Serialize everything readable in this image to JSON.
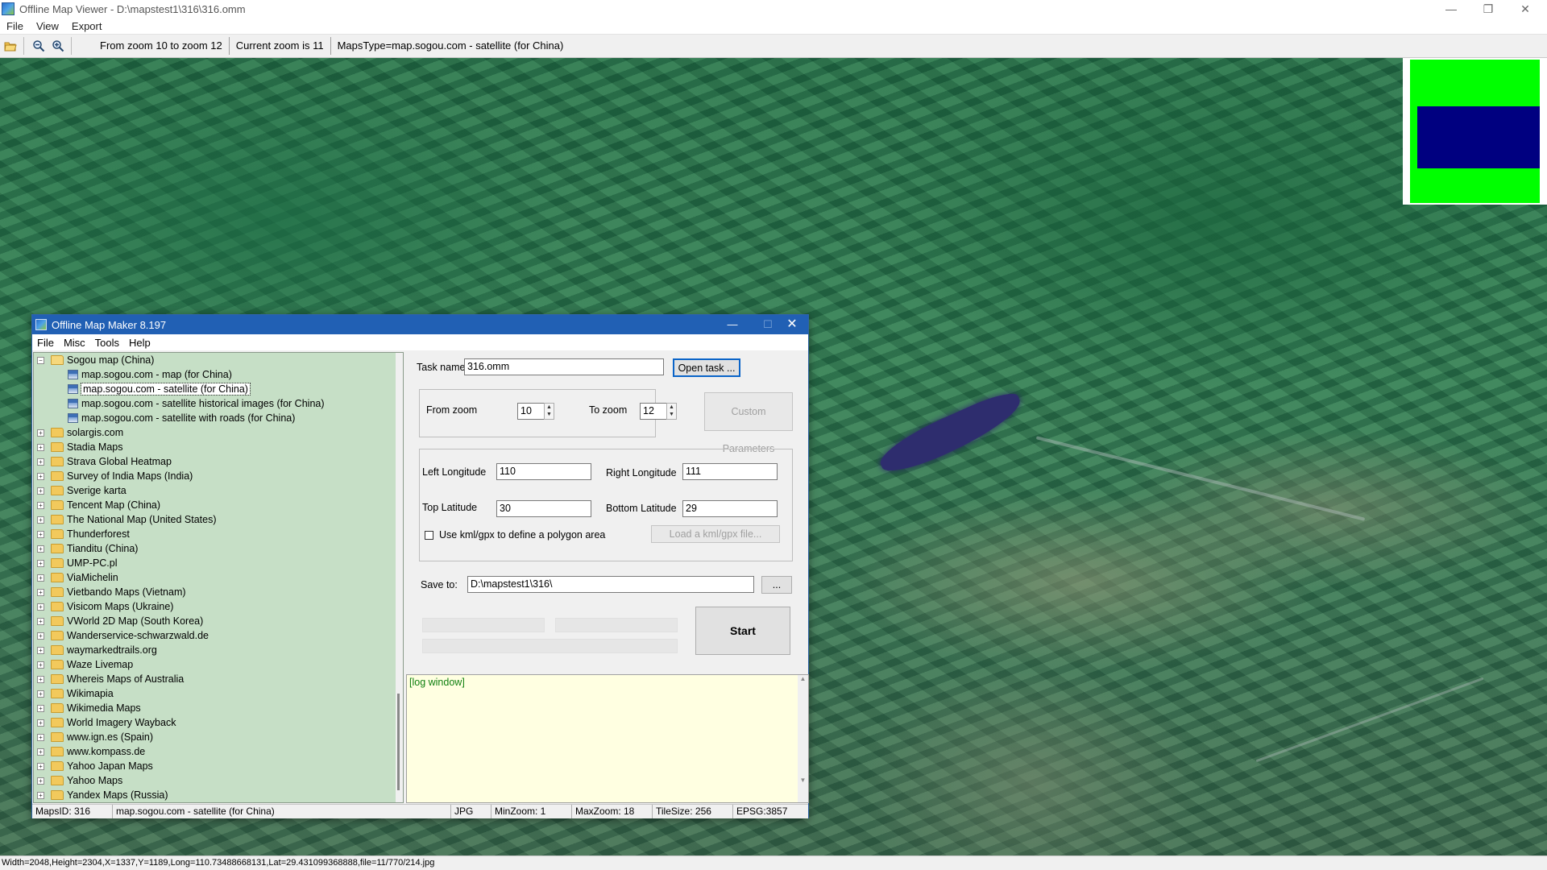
{
  "viewer": {
    "title": "Offline Map Viewer - D:\\mapstest1\\316\\316.omm",
    "window_controls": {
      "minimize": "—",
      "maximize": "❐",
      "close": "✕"
    },
    "menu": [
      "File",
      "View",
      "Export"
    ],
    "toolbar": {
      "zoom_range": "From zoom 10 to zoom 12",
      "current_zoom": "Current zoom is 11",
      "maps_type": "MapsType=map.sogou.com - satellite (for China)"
    },
    "status": "Width=2048,Height=2304,X=1337,Y=1189,Long=110.73488668131,Lat=29.431099368888,file=11/770/214.jpg"
  },
  "overview_colors": {
    "outer": "#00ff00",
    "view": "#000080"
  },
  "maker": {
    "title": "Offline Map Maker 8.197",
    "window_controls": {
      "minimize": "—",
      "maximize": "☐",
      "close": "✕"
    },
    "menu": [
      "File",
      "Misc",
      "Tools",
      "Help"
    ],
    "tree": {
      "root": {
        "label": "Sogou map (China)",
        "expanded": true
      },
      "children": [
        "map.sogou.com - map (for China)",
        "map.sogou.com - satellite (for China)",
        "map.sogou.com - satellite historical images (for China)",
        "map.sogou.com - satellite with roads (for China)"
      ],
      "selected_index": 1,
      "folders": [
        "solargis.com",
        "Stadia Maps",
        "Strava Global Heatmap",
        "Survey of India Maps (India)",
        "Sverige karta",
        "Tencent Map (China)",
        "The National Map (United States)",
        "Thunderforest",
        "Tianditu (China)",
        "UMP-PC.pl",
        "ViaMichelin",
        "Vietbando Maps (Vietnam)",
        "Visicom Maps (Ukraine)",
        "VWorld 2D Map (South Korea)",
        "Wanderservice-schwarzwald.de",
        "waymarkedtrails.org",
        "Waze Livemap",
        "Whereis Maps of Australia",
        "Wikimapia",
        "Wikimedia Maps",
        "World Imagery Wayback",
        "www.ign.es (Spain)",
        "www.kompass.de",
        "Yahoo Japan Maps",
        "Yahoo Maps",
        "Yandex Maps (Russia)"
      ]
    },
    "form": {
      "task_name_label": "Task name",
      "task_name_value": "316.omm",
      "open_task_button": "Open task ...",
      "from_zoom_label": "From zoom",
      "from_zoom_value": "10",
      "to_zoom_label": "To zoom",
      "to_zoom_value": "12",
      "custom_params_button": "Custom Parameters",
      "left_longitude_label": "Left Longitude",
      "left_longitude_value": "110",
      "right_longitude_label": "Right Longitude",
      "right_longitude_value": "111",
      "top_latitude_label": "Top Latitude",
      "top_latitude_value": "30",
      "bottom_latitude_label": "Bottom Latitude",
      "bottom_latitude_value": "29",
      "use_kml_label": "Use kml/gpx to define a polygon area",
      "load_kml_button": "Load a kml/gpx file...",
      "save_to_label": "Save to:",
      "save_to_value": "D:\\mapstest1\\316\\",
      "browse_button": "...",
      "start_button": "Start"
    },
    "log": "[log window]",
    "statusbar": {
      "maps_id": "MapsID: 316",
      "maps_name": "map.sogou.com - satellite (for China)",
      "format": "JPG",
      "min_zoom": "MinZoom: 1",
      "max_zoom": "MaxZoom: 18",
      "tile_size": "TileSize: 256",
      "epsg": "EPSG:3857"
    }
  }
}
